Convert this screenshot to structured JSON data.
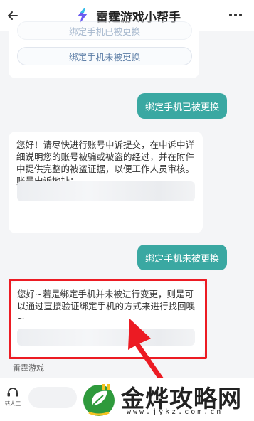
{
  "header": {
    "title": "雷霆游戏小帮手",
    "back_icon": "arrow-left-icon",
    "more_icon": "more-dots-icon",
    "logo_icon": "lightning-logo-icon"
  },
  "messages": {
    "options": [
      "绑定手机已被更换",
      "绑定手机未被更换"
    ],
    "user_reply_1": "绑定手机已被更换",
    "bot_reply_1": {
      "text": "您好！请尽快进行账号申诉提交，在申诉中详细说明您的账号被骗或被盗的经过，并在附件中提供完整的被盗证据，以便工作人员审核。",
      "link_label": "账号申诉地址："
    },
    "user_reply_2": "绑定手机未被更换",
    "bot_reply_2": {
      "text": "您好~若是绑定手机并未被进行变更，则是可以通过直接验证绑定手机的方式来进行找回噢~"
    },
    "sender_name": "雷霆游戏"
  },
  "bottom": {
    "human_label": "转人工",
    "headset_icon": "headset-icon"
  },
  "watermark": {
    "title": "金烨攻略网",
    "url": "www.jykz.com.cn",
    "logo_icon": "plug-leaf-logo-icon"
  },
  "colors": {
    "accent": "#3aa8a2",
    "highlight": "#ec1b23",
    "link": "#5c7da6",
    "background": "#f4f5f7"
  }
}
